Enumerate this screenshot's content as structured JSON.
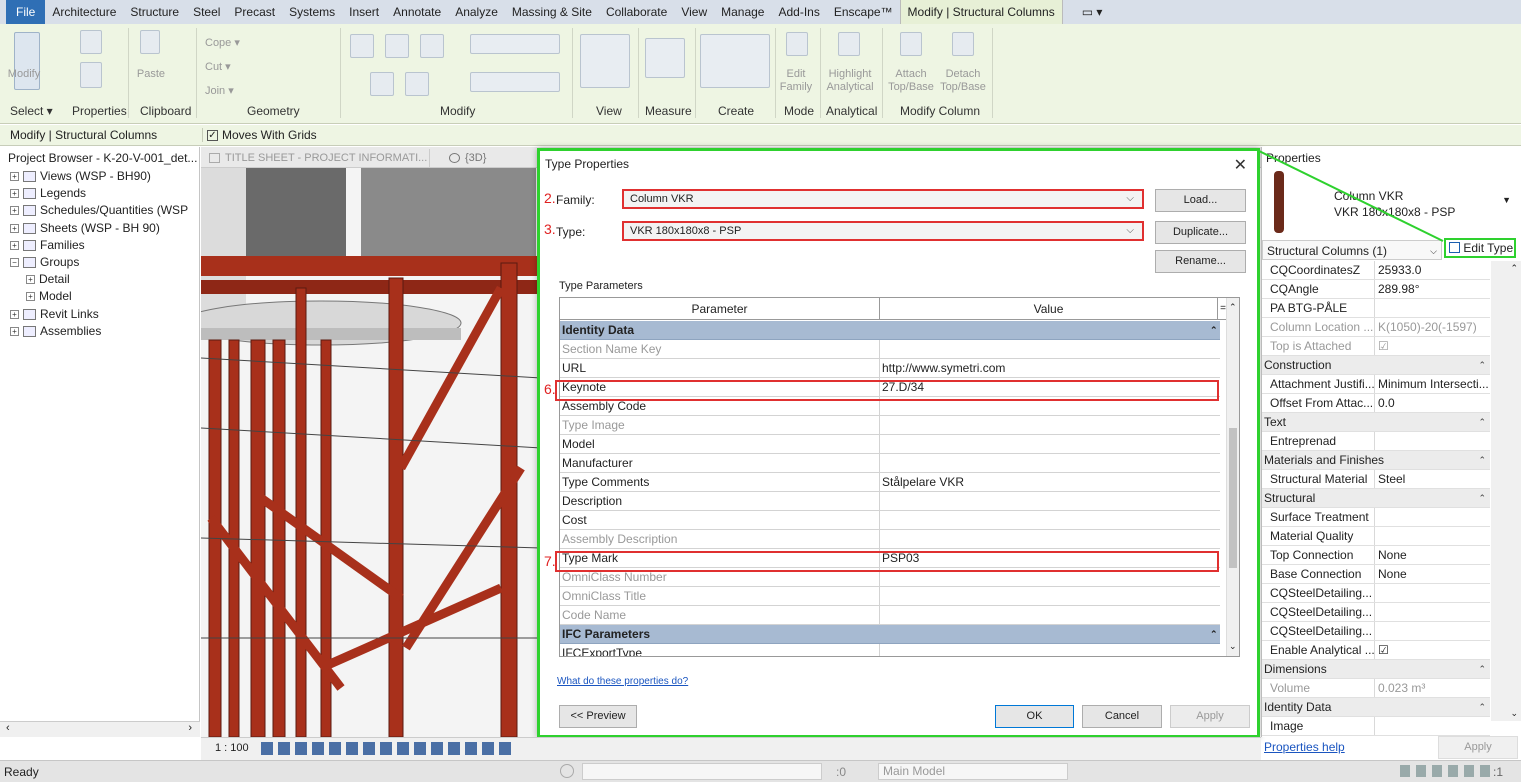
{
  "menu": {
    "items": [
      "File",
      "Architecture",
      "Structure",
      "Steel",
      "Precast",
      "Systems",
      "Insert",
      "Annotate",
      "Analyze",
      "Massing & Site",
      "Collaborate",
      "View",
      "Manage",
      "Add-Ins",
      "Enscape™",
      "Modify | Structural Columns"
    ],
    "extra": "▭ ▾"
  },
  "ribbon": {
    "tools": {
      "modify": "Modify",
      "paste": "Paste",
      "cope": "Cope ▾",
      "cut": "Cut ▾",
      "join": "Join ▾",
      "edit_family": "Edit\nFamily",
      "highlight_analytical": "Highlight\nAnalytical",
      "attach": "Attach\nTop/Base",
      "detach": "Detach\nTop/Base"
    },
    "panels": {
      "select": "Select ▾",
      "properties": "Properties",
      "clipboard": "Clipboard",
      "geometry": "Geometry",
      "modify": "Modify",
      "view": "View",
      "measure": "Measure",
      "create": "Create",
      "mode": "Mode",
      "analytical": "Analytical",
      "modify_column": "Modify Column"
    }
  },
  "optionbar": {
    "context": "Modify | Structural Columns",
    "moves_with_grids": "Moves With Grids"
  },
  "project_browser": {
    "title": "Project Browser - K-20-V-001_det...",
    "items": [
      "Views (WSP - BH90)",
      "Legends",
      "Schedules/Quantities (WSP",
      "Sheets (WSP - BH 90)",
      "Families",
      "Groups",
      "Detail",
      "Model",
      "Revit Links",
      "Assemblies"
    ]
  },
  "view_tabs": {
    "sheet": "TITLE SHEET - PROJECT INFORMATI...",
    "threed": "{3D}"
  },
  "dialog": {
    "title": "Type Properties",
    "family_label": "Family:",
    "family_value": "Column VKR",
    "type_label": "Type:",
    "type_value": "VKR 180x180x8 - PSP",
    "step_family": "2.",
    "step_type": "3.",
    "step_keynote": "6.",
    "step_typemark": "7.",
    "load": "Load...",
    "duplicate": "Duplicate...",
    "rename": "Rename...",
    "type_parameters": "Type Parameters",
    "col_parameter": "Parameter",
    "col_value": "Value",
    "col_eq": "=",
    "rows": [
      {
        "p": "Identity Data",
        "v": "",
        "kind": "group"
      },
      {
        "p": "Section Name Key",
        "v": "",
        "kind": "gray"
      },
      {
        "p": "URL",
        "v": "http://www.symetri.com",
        "kind": "normal"
      },
      {
        "p": "Keynote",
        "v": "27.D/34",
        "kind": "normal"
      },
      {
        "p": "Assembly Code",
        "v": "",
        "kind": "normal"
      },
      {
        "p": "Type Image",
        "v": "",
        "kind": "gray"
      },
      {
        "p": "Model",
        "v": "",
        "kind": "normal"
      },
      {
        "p": "Manufacturer",
        "v": "",
        "kind": "normal"
      },
      {
        "p": "Type Comments",
        "v": "Stålpelare VKR",
        "kind": "normal"
      },
      {
        "p": "Description",
        "v": "",
        "kind": "normal"
      },
      {
        "p": "Cost",
        "v": "",
        "kind": "normal"
      },
      {
        "p": "Assembly Description",
        "v": "",
        "kind": "gray"
      },
      {
        "p": "Type Mark",
        "v": "PSP03",
        "kind": "normal"
      },
      {
        "p": "OmniClass Number",
        "v": "",
        "kind": "gray"
      },
      {
        "p": "OmniClass Title",
        "v": "",
        "kind": "gray"
      },
      {
        "p": "Code Name",
        "v": "",
        "kind": "gray"
      },
      {
        "p": "IFC Parameters",
        "v": "",
        "kind": "group"
      },
      {
        "p": "IFCExportType",
        "v": "",
        "kind": "normal"
      }
    ],
    "help_link": "What do these properties do?",
    "preview": "<< Preview",
    "ok": "OK",
    "cancel": "Cancel",
    "apply": "Apply"
  },
  "properties": {
    "title": "Properties",
    "family": "Column VKR",
    "type": "VKR 180x180x8 - PSP",
    "selector": "Structural Columns (1)",
    "edit_type": "Edit Type",
    "rows": [
      {
        "k": "CQCoordinatesZ",
        "v": "25933.0",
        "kind": "normal"
      },
      {
        "k": "CQAngle",
        "v": "289.98°",
        "kind": "normal"
      },
      {
        "k": "PA BTG-PÅLE",
        "v": "",
        "kind": "normal"
      },
      {
        "k": "Column Location ...",
        "v": "K(1050)-20(-1597)",
        "kind": "gray"
      },
      {
        "k": "Top is Attached",
        "v": "☑",
        "kind": "gray"
      },
      {
        "k": "Construction",
        "v": "",
        "kind": "cat"
      },
      {
        "k": "Attachment Justifi...",
        "v": "Minimum Intersecti...",
        "kind": "normal"
      },
      {
        "k": "Offset From Attac...",
        "v": "0.0",
        "kind": "normal"
      },
      {
        "k": "Text",
        "v": "",
        "kind": "cat"
      },
      {
        "k": "Entreprenad",
        "v": "",
        "kind": "normal"
      },
      {
        "k": "Materials and Finishes",
        "v": "",
        "kind": "cat"
      },
      {
        "k": "Structural Material",
        "v": "Steel",
        "kind": "normal"
      },
      {
        "k": "Structural",
        "v": "",
        "kind": "cat"
      },
      {
        "k": "Surface Treatment",
        "v": "",
        "kind": "normal"
      },
      {
        "k": "Material Quality",
        "v": "",
        "kind": "normal"
      },
      {
        "k": "Top Connection",
        "v": "None",
        "kind": "normal"
      },
      {
        "k": "Base Connection",
        "v": "None",
        "kind": "normal"
      },
      {
        "k": "CQSteelDetailing...",
        "v": "",
        "kind": "normal"
      },
      {
        "k": "CQSteelDetailing...",
        "v": "",
        "kind": "normal"
      },
      {
        "k": "CQSteelDetailing...",
        "v": "",
        "kind": "normal"
      },
      {
        "k": "Enable Analytical ...",
        "v": "☑",
        "kind": "normal"
      },
      {
        "k": "Dimensions",
        "v": "",
        "kind": "cat"
      },
      {
        "k": "Volume",
        "v": "0.023 m³",
        "kind": "gray"
      },
      {
        "k": "Identity Data",
        "v": "",
        "kind": "cat"
      },
      {
        "k": "Image",
        "v": "",
        "kind": "normal"
      }
    ],
    "help": "Properties help",
    "apply": "Apply"
  },
  "viewctl": {
    "scale": "1 : 100"
  },
  "status": {
    "ready": "Ready",
    "worksets": ":0",
    "model": "Main Model",
    "filter": ":1"
  },
  "colors": {
    "highlight_green": "#2ed12e",
    "red_box": "#e03030",
    "steel_red": "#a8301b",
    "group_blue": "#a7bad2"
  }
}
